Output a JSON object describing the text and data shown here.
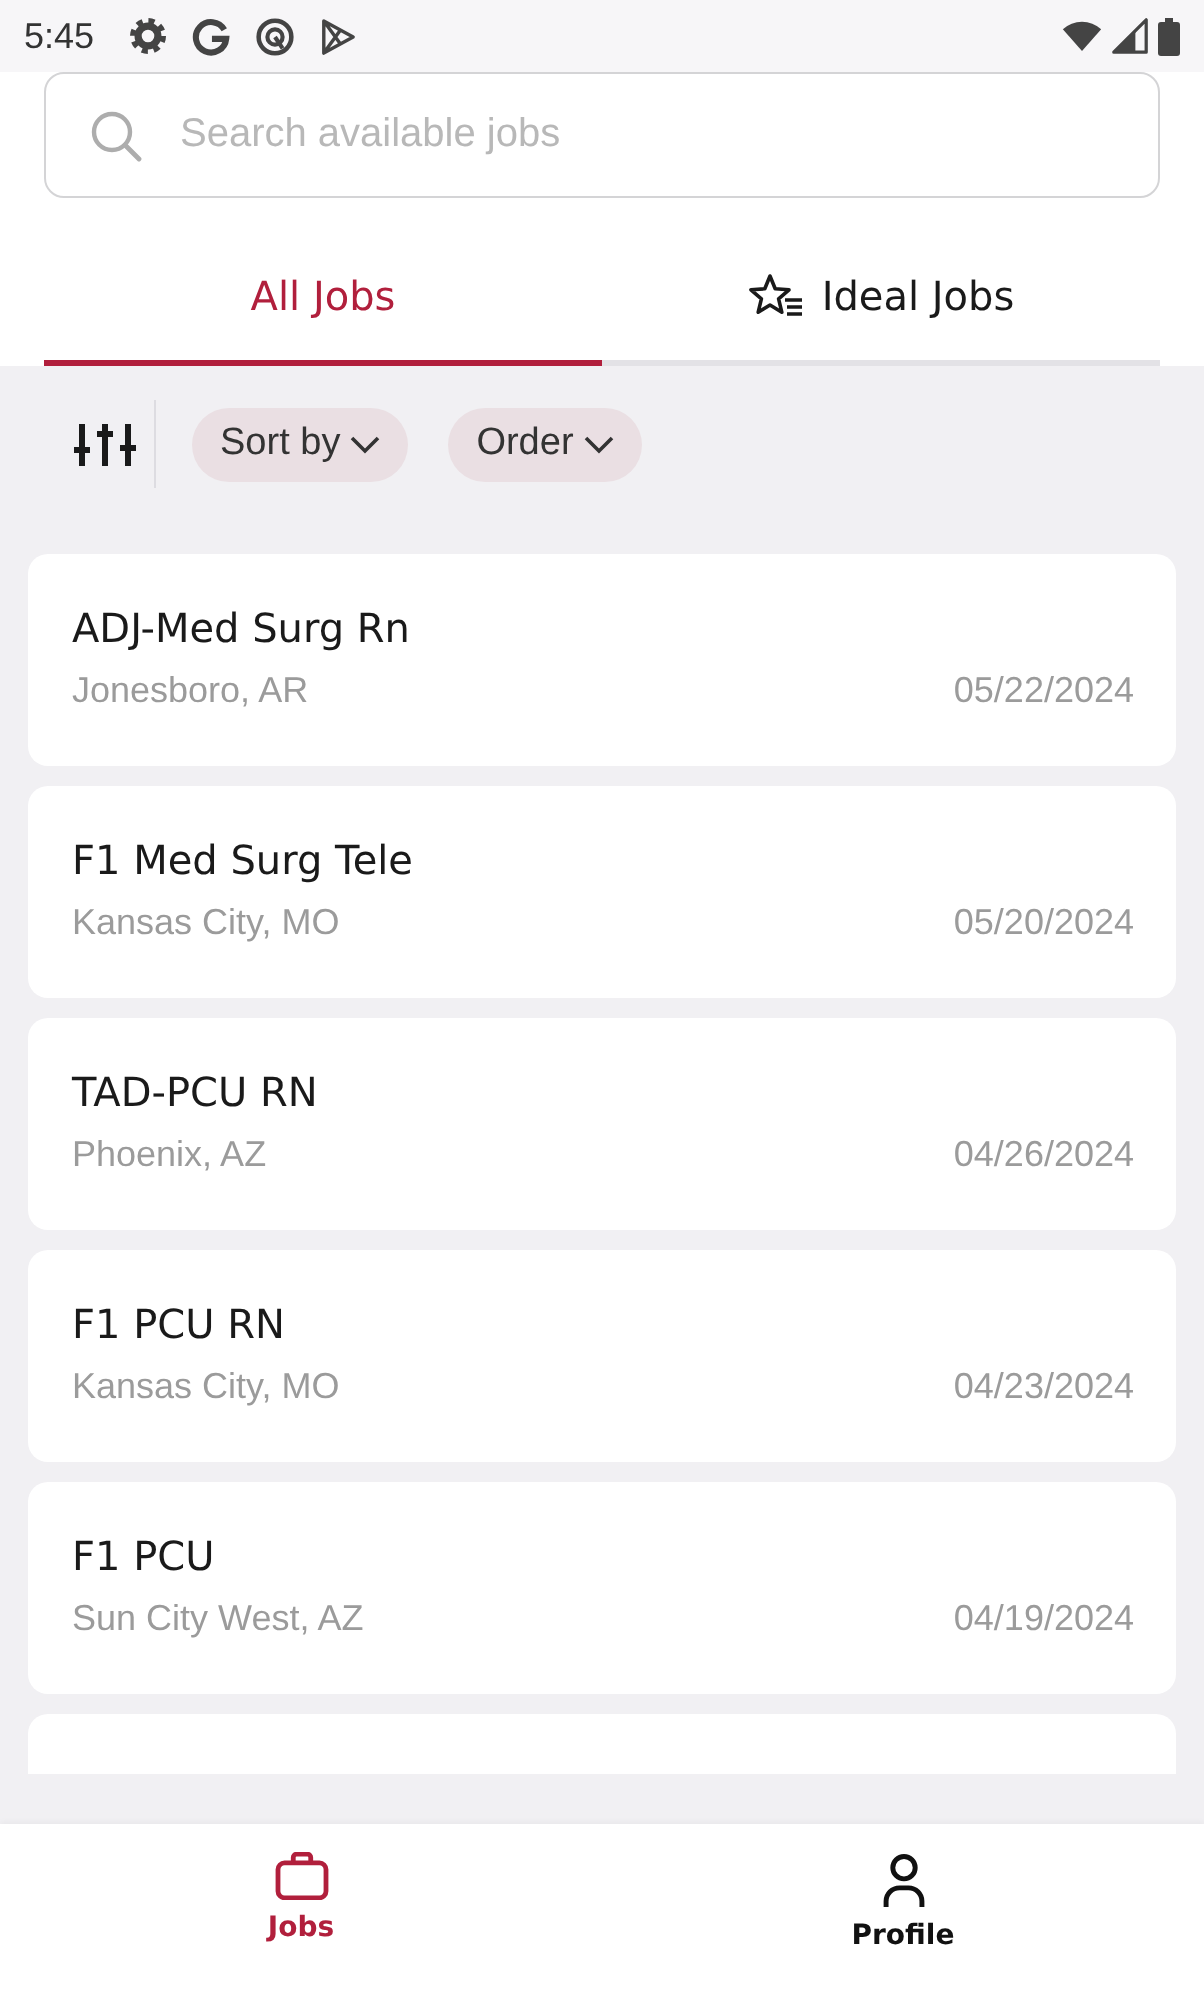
{
  "status_bar": {
    "time": "5:45"
  },
  "search": {
    "placeholder": "Search available jobs"
  },
  "tabs": [
    {
      "label": "All Jobs",
      "selected": true,
      "kind": "plain"
    },
    {
      "label": "Ideal Jobs",
      "selected": false,
      "kind": "starred"
    }
  ],
  "filters": [
    {
      "label": "Sort by"
    },
    {
      "label": "Order"
    }
  ],
  "jobs": [
    {
      "title": "ADJ-Med Surg Rn",
      "location": "Jonesboro, AR",
      "date": "05/22/2024"
    },
    {
      "title": "F1 Med Surg Tele",
      "location": "Kansas City, MO",
      "date": "05/20/2024"
    },
    {
      "title": "TAD-PCU RN",
      "location": "Phoenix, AZ",
      "date": "04/26/2024"
    },
    {
      "title": "F1 PCU RN",
      "location": "Kansas City, MO",
      "date": "04/23/2024"
    },
    {
      "title": "F1 PCU",
      "location": "Sun City West, AZ",
      "date": "04/19/2024"
    }
  ],
  "nav": [
    {
      "label": "Jobs",
      "selected": true,
      "kind": "briefcase"
    },
    {
      "label": "Profile",
      "selected": false,
      "kind": "person"
    }
  ]
}
